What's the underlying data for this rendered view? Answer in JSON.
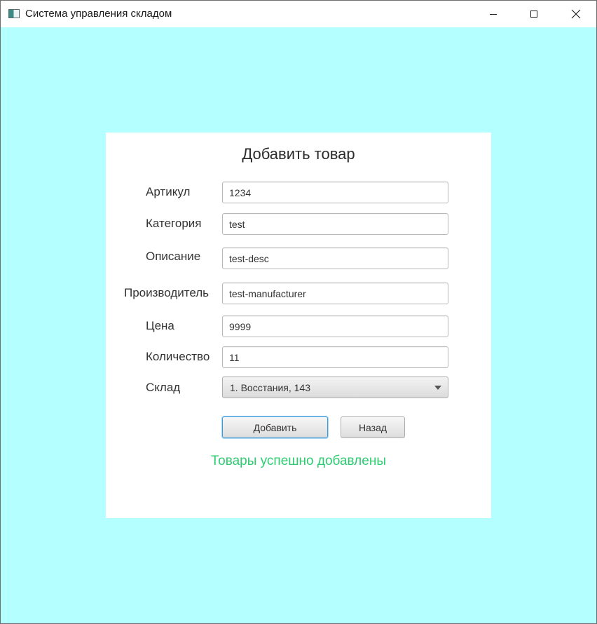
{
  "window": {
    "title": "Система управления складом",
    "icons": {
      "app": "app-icon",
      "minimize": "minimize-icon",
      "maximize": "maximize-icon",
      "close": "close-icon"
    }
  },
  "form": {
    "title": "Добавить товар",
    "fields": {
      "article": {
        "label": "Артикул",
        "value": "1234"
      },
      "category": {
        "label": "Категория",
        "value": "test"
      },
      "description": {
        "label": "Описание",
        "value": "test-desc"
      },
      "manufacturer": {
        "label": "Производитель",
        "value": "test-manufacturer"
      },
      "price": {
        "label": "Цена",
        "value": "9999"
      },
      "quantity": {
        "label": "Количество",
        "value": "11"
      },
      "warehouse": {
        "label": "Склад",
        "value": "1. Восстания, 143"
      }
    },
    "buttons": {
      "add": "Добавить",
      "back": "Назад"
    },
    "status": "Товары успешно добавлены"
  },
  "colors": {
    "background": "#b4ffff",
    "panel": "#ffffff",
    "status_text": "#2ecc71",
    "focus_border": "#3c9ad9"
  }
}
